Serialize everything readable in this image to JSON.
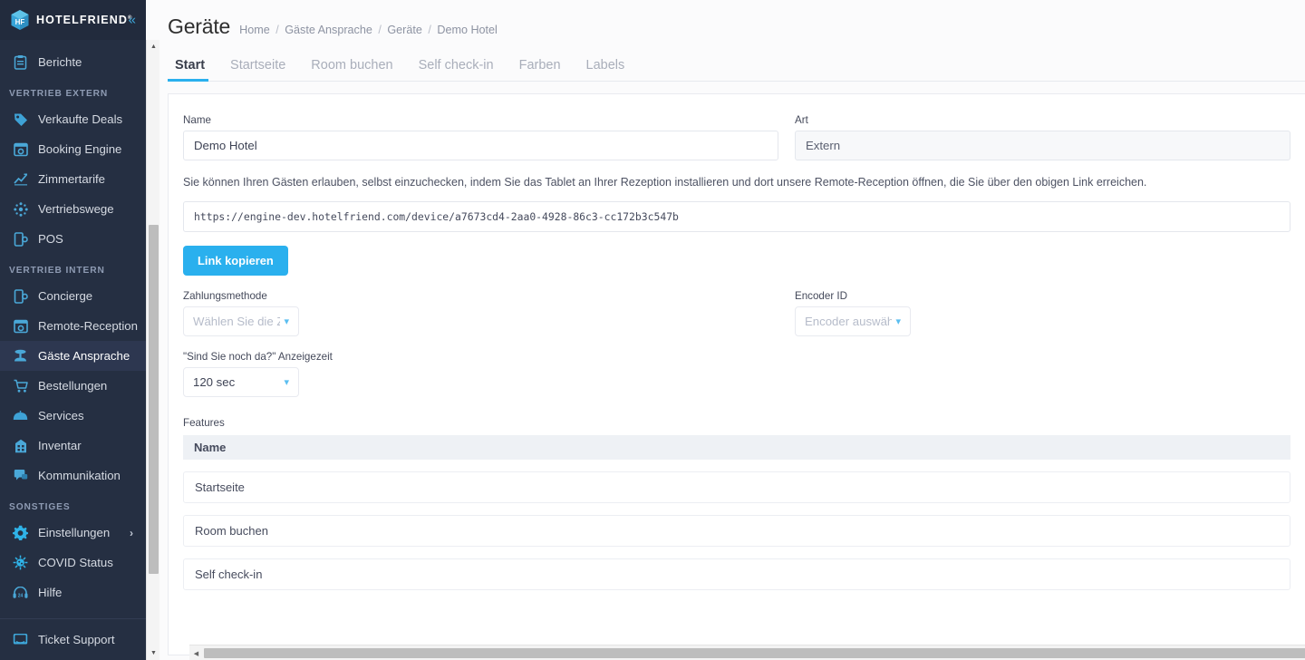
{
  "brand": {
    "name": "HOTELFRIEND",
    "registered": "®",
    "collapse_icon": "chevron-left-double"
  },
  "sidebar": {
    "top_items": [
      {
        "label": "Berichte",
        "icon": "clipboard-icon"
      }
    ],
    "sections": [
      {
        "title": "VERTRIEB EXTERN",
        "items": [
          {
            "label": "Verkaufte Deals",
            "icon": "tag-icon"
          },
          {
            "label": "Booking Engine",
            "icon": "browser-window-icon"
          },
          {
            "label": "Zimmertarife",
            "icon": "chart-line-icon"
          },
          {
            "label": "Vertriebswege",
            "icon": "network-nodes-icon"
          },
          {
            "label": "POS",
            "icon": "mobile-device-icon"
          }
        ]
      },
      {
        "title": "VERTRIEB INTERN",
        "items": [
          {
            "label": "Concierge",
            "icon": "mobile-device-icon"
          },
          {
            "label": "Remote-Reception",
            "icon": "browser-window-icon"
          },
          {
            "label": "Gäste Ansprache",
            "icon": "reception-desk-icon",
            "active": true
          },
          {
            "label": "Bestellungen",
            "icon": "shopping-cart-icon"
          },
          {
            "label": "Services",
            "icon": "room-service-tray-icon"
          },
          {
            "label": "Inventar",
            "icon": "building-icon"
          },
          {
            "label": "Kommunikation",
            "icon": "chat-bubble-icon"
          }
        ]
      },
      {
        "title": "SONSTIGES",
        "items": [
          {
            "label": "Einstellungen",
            "icon": "gear-icon",
            "chevron": "›"
          },
          {
            "label": "COVID Status",
            "icon": "virus-icon"
          },
          {
            "label": "Hilfe",
            "icon": "headset-24h-icon"
          }
        ]
      }
    ],
    "bottom_item": {
      "label": "Ticket Support",
      "icon": "monitor-icon"
    }
  },
  "header": {
    "title": "Geräte",
    "breadcrumb": [
      "Home",
      "Gäste Ansprache",
      "Geräte",
      "Demo Hotel"
    ],
    "breadcrumb_separator": "/"
  },
  "tabs": [
    {
      "label": "Start",
      "active": true
    },
    {
      "label": "Startseite",
      "active": false
    },
    {
      "label": "Room buchen",
      "active": false
    },
    {
      "label": "Self check-in",
      "active": false
    },
    {
      "label": "Farben",
      "active": false
    },
    {
      "label": "Labels",
      "active": false
    }
  ],
  "form": {
    "name_label": "Name",
    "name_value": "Demo Hotel",
    "art_label": "Art",
    "art_value": "Extern",
    "description": "Sie können Ihren Gästen erlauben, selbst einzuchecken, indem Sie das Tablet an Ihrer Rezeption installieren und dort unsere Remote-Reception öffnen, die Sie über den obigen Link erreichen.",
    "device_url": "https://engine-dev.hotelfriend.com/device/a7673cd4-2aa0-4928-86c3-cc172b3c547b",
    "copy_button": "Link kopieren",
    "payment_label": "Zahlungsmethode",
    "payment_placeholder": "Wählen Sie die Zah",
    "encoder_label": "Encoder ID",
    "encoder_placeholder": "Encoder auswähle",
    "idle_label": "\"Sind Sie noch da?\" Anzeigezeit",
    "idle_value": "120 sec",
    "chevron_icon": "chevron-down-icon"
  },
  "features": {
    "label": "Features",
    "column_header": "Name",
    "rows": [
      "Startseite",
      "Room buchen",
      "Self check-in"
    ]
  },
  "scrollbars": {
    "h_left_arrow": "◀",
    "v_up_arrow": "▲",
    "v_down_arrow": "▼"
  },
  "colors": {
    "sidebar_bg": "#252f42",
    "sidebar_active": "#2d3750",
    "accent": "#2ab0ee",
    "icon_blue": "#3ea9dd"
  }
}
